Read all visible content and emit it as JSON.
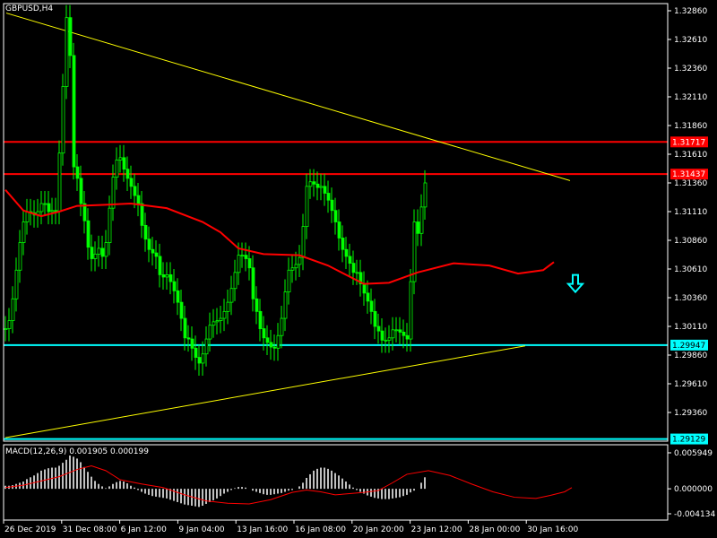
{
  "chart_data": [
    {
      "type": "candlestick",
      "title": "GBPUSD,H4",
      "ylim": [
        1.29,
        1.33
      ],
      "y_ticks": [
        "1.32860",
        "1.32610",
        "1.32360",
        "1.32110",
        "1.31860",
        "1.31610",
        "1.31360",
        "1.31110",
        "1.30860",
        "1.30610",
        "1.30360",
        "1.30110",
        "1.29860",
        "1.29610",
        "1.29360"
      ],
      "x_ticks": [
        "26 Dec 2019",
        "31 Dec 08:00",
        "6 Jan 12:00",
        "9 Jan 04:00",
        "13 Jan 16:00",
        "16 Jan 08:00",
        "20 Jan 20:00",
        "23 Jan 12:00",
        "28 Jan 00:00",
        "30 Jan 16:00"
      ],
      "horizontal_levels": [
        {
          "value": 1.31717,
          "label": "1.31717",
          "color": "#ff0000"
        },
        {
          "value": 1.31437,
          "label": "1.31437",
          "color": "#ff0000"
        },
        {
          "value": 1.29947,
          "label": "1.29947",
          "color": "#00ffff"
        },
        {
          "value": 1.29129,
          "label": "1.29129",
          "color": "#00ffff"
        }
      ],
      "trendlines": [
        {
          "name": "resistance",
          "color": "#ffff00",
          "from": [
            0.25,
            1.3284
          ],
          "to": [
            157.5,
            1.3138
          ]
        },
        {
          "name": "support",
          "color": "#ffff00",
          "from": [
            0,
            1.2914
          ],
          "to": [
            145,
            1.2994
          ]
        }
      ],
      "close": [
        1.3009,
        1.3016,
        1.3035,
        1.306,
        1.3084,
        1.3102,
        1.3111,
        1.311,
        1.3108,
        1.3111,
        1.3118,
        1.3118,
        1.3111,
        1.3112,
        1.3111,
        1.3162,
        1.322,
        1.328,
        1.3247,
        1.315,
        1.314,
        1.3118,
        1.3103,
        1.308,
        1.307,
        1.3074,
        1.3079,
        1.3072,
        1.3084,
        1.3114,
        1.3141,
        1.3156,
        1.3158,
        1.3148,
        1.314,
        1.3133,
        1.3125,
        1.3118,
        1.3099,
        1.3087,
        1.3078,
        1.3075,
        1.3072,
        1.3056,
        1.3054,
        1.3056,
        1.305,
        1.3042,
        1.3032,
        1.3018,
        1.3001,
        1.3,
        1.2992,
        1.2984,
        1.2979,
        1.2987,
        1.3,
        1.3012,
        1.3015,
        1.3016,
        1.3018,
        1.3024,
        1.3032,
        1.3044,
        1.3058,
        1.3073,
        1.3073,
        1.307,
        1.3062,
        1.3035,
        1.3024,
        1.3009,
        1.3001,
        1.2997,
        1.2993,
        1.2992,
        1.3003,
        1.3018,
        1.3041,
        1.306,
        1.3062,
        1.3065,
        1.3071,
        1.3098,
        1.3133,
        1.3137,
        1.3135,
        1.3132,
        1.3133,
        1.3127,
        1.3121,
        1.3112,
        1.3102,
        1.3088,
        1.3078,
        1.3072,
        1.3066,
        1.3058,
        1.3058,
        1.3048,
        1.304,
        1.3033,
        1.3024,
        1.3011,
        1.3007,
        1.2999,
        1.2999,
        1.3001,
        1.3008,
        1.3008,
        1.3006,
        1.3003,
        1.3,
        1.305,
        1.3102,
        1.3092,
        1.3115,
        1.3136
      ],
      "moving_average": {
        "color": "#ff0000",
        "points": [
          [
            0,
            1.313
          ],
          [
            5,
            1.3112
          ],
          [
            10,
            1.3107
          ],
          [
            15,
            1.3111
          ],
          [
            20,
            1.3116
          ],
          [
            28,
            1.3117
          ],
          [
            35,
            1.3118
          ],
          [
            45,
            1.3114
          ],
          [
            55,
            1.3102
          ],
          [
            60,
            1.3093
          ],
          [
            65,
            1.3079
          ],
          [
            72,
            1.3074
          ],
          [
            82,
            1.3073
          ],
          [
            90,
            1.3064
          ],
          [
            100,
            1.3048
          ],
          [
            107,
            1.3049
          ],
          [
            115,
            1.3058
          ],
          [
            125,
            1.3066
          ],
          [
            135,
            1.3064
          ],
          [
            143,
            1.3057
          ],
          [
            150,
            1.306
          ],
          [
            153,
            1.3067
          ]
        ]
      },
      "arrow": {
        "index": 159,
        "value": 1.3048,
        "direction": "down",
        "color": "#00ffff"
      }
    },
    {
      "type": "histogram",
      "title": "MACD(12,26,9) 0.001905 0.000199",
      "ylim": [
        -0.0043,
        0.00625
      ],
      "y_ticks": [
        "0.005949",
        "0.000000",
        "-0.004134"
      ],
      "series": [
        {
          "values": [
            0.0005,
            0.0005,
            0.0006,
            0.0008,
            0.001,
            0.0012,
            0.0016,
            0.0019,
            0.0022,
            0.0026,
            0.003,
            0.0032,
            0.0034,
            0.0035,
            0.0035,
            0.0038,
            0.0043,
            0.0048,
            0.0055,
            0.0053,
            0.005,
            0.0044,
            0.0036,
            0.0028,
            0.002,
            0.0013,
            0.0008,
            0.0004,
            0.0001,
            0.0004,
            0.0008,
            0.0011,
            0.0013,
            0.0012,
            0.0009,
            0.0005,
            0.0002,
            -0.0002,
            -0.0005,
            -0.0008,
            -0.001,
            -0.0012,
            -0.0013,
            -0.0014,
            -0.0015,
            -0.0016,
            -0.0018,
            -0.002,
            -0.0022,
            -0.0024,
            -0.0026,
            -0.0027,
            -0.0028,
            -0.0029,
            -0.003,
            -0.0028,
            -0.0025,
            -0.0022,
            -0.0019,
            -0.0016,
            -0.0012,
            -0.0008,
            -0.0005,
            -0.0002,
            0.0001,
            0.0003,
            0.0003,
            0.0002,
            0.0,
            -0.0003,
            -0.0005,
            -0.0007,
            -0.0009,
            -0.001,
            -0.001,
            -0.0009,
            -0.0008,
            -0.0007,
            -0.0005,
            -0.0003,
            -0.0002,
            0.0,
            0.0004,
            0.001,
            0.0018,
            0.0024,
            0.003,
            0.0033,
            0.0035,
            0.0035,
            0.0033,
            0.003,
            0.0026,
            0.0022,
            0.0017,
            0.0012,
            0.0007,
            0.0002,
            -0.0002,
            -0.0005,
            -0.0008,
            -0.0011,
            -0.0013,
            -0.0015,
            -0.0016,
            -0.0017,
            -0.0017,
            -0.0017,
            -0.0016,
            -0.0015,
            -0.0014,
            -0.0012,
            -0.001,
            -0.0006,
            -0.0003,
            0.0,
            0.001,
            0.0019
          ]
        },
        {
          "color": "#ff0000",
          "points": [
            [
              0,
              0.0002
            ],
            [
              5,
              0.0006
            ],
            [
              10,
              0.0013
            ],
            [
              15,
              0.002
            ],
            [
              20,
              0.0032
            ],
            [
              24,
              0.0038
            ],
            [
              28,
              0.003
            ],
            [
              32,
              0.0015
            ],
            [
              38,
              0.0008
            ],
            [
              44,
              0.0002
            ],
            [
              50,
              -0.001
            ],
            [
              56,
              -0.002
            ],
            [
              62,
              -0.0024
            ],
            [
              68,
              -0.0025
            ],
            [
              74,
              -0.0018
            ],
            [
              80,
              -0.0006
            ],
            [
              84,
              -0.0002
            ],
            [
              88,
              -0.0005
            ],
            [
              92,
              -0.001
            ],
            [
              96,
              -0.0008
            ],
            [
              100,
              -0.0006
            ],
            [
              104,
              -0.0003
            ],
            [
              108,
              0.001
            ],
            [
              112,
              0.0024
            ],
            [
              118,
              0.003
            ],
            [
              124,
              0.0022
            ],
            [
              130,
              0.0008
            ],
            [
              136,
              -0.0005
            ],
            [
              142,
              -0.0014
            ],
            [
              148,
              -0.0016
            ],
            [
              152,
              -0.0011
            ],
            [
              156,
              -0.0005
            ],
            [
              158,
              0.0002
            ]
          ]
        }
      ]
    }
  ]
}
